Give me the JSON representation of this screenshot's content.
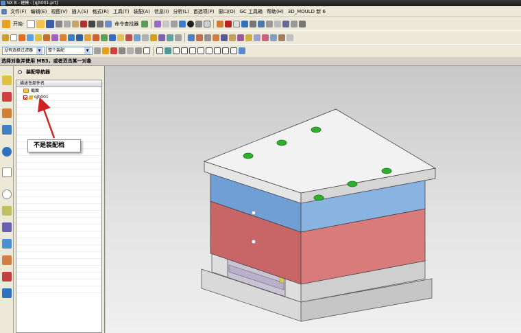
{
  "window": {
    "title": "NX 8 - 建模 - [qjh001.prt]"
  },
  "menu": [
    "文件(F)",
    "编辑(E)",
    "视图(V)",
    "插入(S)",
    "格式(R)",
    "工具(T)",
    "装配(A)",
    "信息(I)",
    "分析(L)",
    "首选项(P)",
    "窗口(O)",
    "GC 工具箱",
    "帮助(H)",
    "3D_MOULD 新 6"
  ],
  "toolbar": {
    "start_label": "开始·",
    "command_finder_label": "命令查找器"
  },
  "selection": {
    "filter_value": "没有选择过滤器",
    "scope_value": "整个装配"
  },
  "cue_line": "选择对象并使用 MB3，或者双击某一对象",
  "navigator": {
    "title": "装配导航器",
    "column_header": "描述性部件名",
    "items": [
      {
        "label": "截面"
      },
      {
        "label": "qjh001",
        "checked": true
      }
    ]
  },
  "annotation": {
    "text": "不是装配档"
  },
  "colors": {
    "top_plate": "#f2f2f2",
    "blue_plate": "#6f9fd4",
    "red_plate": "#c86566",
    "holes": "#2eb02e",
    "annotation_arrow": "#d02020"
  }
}
